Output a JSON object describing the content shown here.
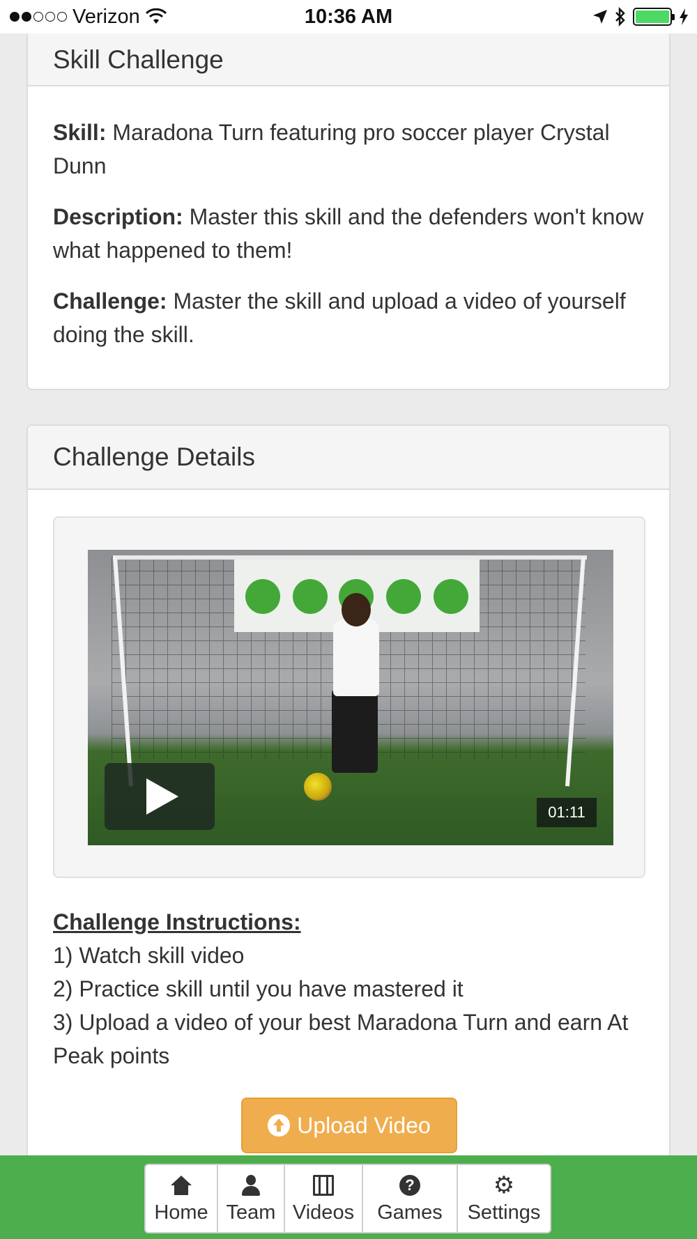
{
  "status_bar": {
    "carrier": "Verizon",
    "time": "10:36 AM",
    "signal_bars": 2,
    "battery_level": 1.0
  },
  "skill_panel": {
    "title": "Skill Challenge",
    "skill_label": "Skill:",
    "skill_value": "Maradona Turn featuring pro soccer player Crystal Dunn",
    "description_label": "Description:",
    "description_value": "Master this skill and the defenders won't know what happened to them!",
    "challenge_label": "Challenge:",
    "challenge_value": "Master the skill and upload a video of yourself doing the skill."
  },
  "details_panel": {
    "title": "Challenge Details",
    "video_duration": "01:11",
    "instructions_title": "Challenge Instructions:",
    "instructions": [
      "1) Watch skill video",
      "2) Practice skill until you have mastered it",
      "3) Upload a video of your best Maradona Turn and earn At Peak points"
    ],
    "upload_label": "Upload Video"
  },
  "nav": {
    "items": [
      {
        "label": "Home",
        "icon": "home-icon"
      },
      {
        "label": "Team",
        "icon": "user-icon"
      },
      {
        "label": "Videos",
        "icon": "film-icon"
      },
      {
        "label": "Games",
        "icon": "question-circle-icon"
      },
      {
        "label": "Settings",
        "icon": "gear-icon"
      }
    ]
  },
  "colors": {
    "nav_bar_green": "#4cae4c",
    "upload_orange": "#f0ad4e",
    "battery_green": "#4cd964"
  }
}
